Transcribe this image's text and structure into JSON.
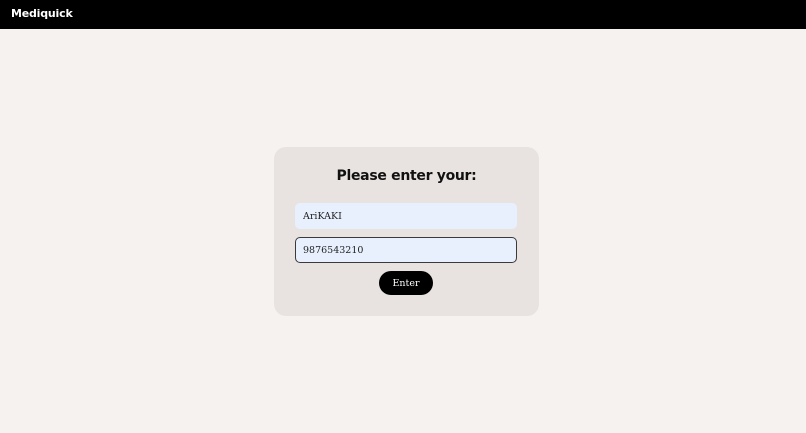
{
  "app": {
    "brand": "Mediquick"
  },
  "form": {
    "title": "Please enter your:",
    "name_value": "AriKAKI",
    "phone_value": "9876543210",
    "submit_label": "Enter"
  },
  "colors": {
    "topbar": "#000000",
    "page_background": "#f5f2f0",
    "card_background": "#e8e3e0",
    "input_background": "#e8f0fe",
    "button_background": "#000000"
  }
}
